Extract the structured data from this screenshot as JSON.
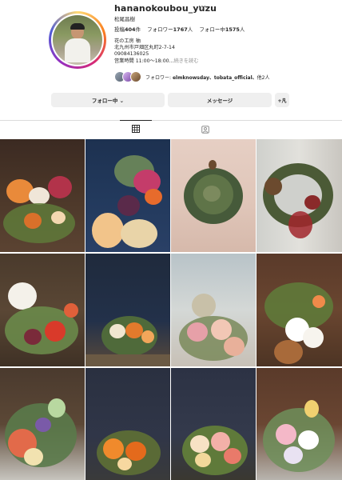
{
  "profile": {
    "username": "hananokoubou_yuzu",
    "more_icon": "⋯",
    "fullname": "松尾昌樹",
    "stats": {
      "posts_label": "投稿",
      "posts": "404",
      "posts_unit": "件",
      "followers_label": "フォロワー",
      "followers": "1767",
      "followers_unit": "人",
      "following_label": "フォロー中",
      "following": "1575",
      "following_unit": "人"
    },
    "bio": {
      "line1": "花の工房 柚",
      "line2": "北九州市戸畑区丸町2-7-14",
      "line3": "09084136025",
      "line4": "営業時間 11:00～18:00...",
      "more_label": "続きを読む"
    },
    "followed_by": {
      "prefix": "フォロワー: ",
      "names": "elmknowsday、tobata_official、",
      "suffix": "他2人"
    }
  },
  "actions": {
    "follow_label": "フォロー中 ⌄",
    "message_label": "メッセージ",
    "add_label": "+凡"
  },
  "tabs": [
    {
      "name": "grid-icon",
      "active": true
    },
    {
      "name": "tagged-icon",
      "active": false
    }
  ],
  "posts": [
    {
      "name": "post-flower-arrangement-wood-wall"
    },
    {
      "name": "post-bouquet-anthurium-dark"
    },
    {
      "name": "post-greenery-wreath-pink-wall"
    },
    {
      "name": "post-pinecone-wreath"
    },
    {
      "name": "post-anthurium-arrangement-window"
    },
    {
      "name": "post-orange-arrangement-dark"
    },
    {
      "name": "post-pink-roses-arrangement"
    },
    {
      "name": "post-orchid-arrangement-wood"
    },
    {
      "name": "post-bouquet-green-anthurium"
    },
    {
      "name": "post-orange-roses-arrangement"
    },
    {
      "name": "post-pink-white-arrangement"
    },
    {
      "name": "post-pastel-bouquet"
    }
  ],
  "colors": {
    "accent_gradient": [
      "#feda75",
      "#fa7e1e",
      "#d62976",
      "#962fbf",
      "#4f5bd5"
    ],
    "button_bg": "#efefef",
    "text": "#262626",
    "muted": "#8e8e8e"
  }
}
